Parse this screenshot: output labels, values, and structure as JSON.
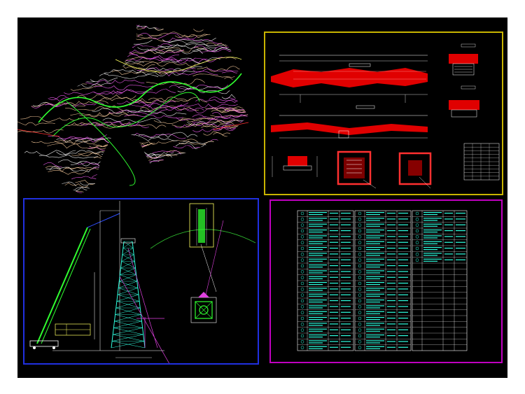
{
  "drawing": {
    "background": "#000000",
    "frame_colors": {
      "bridge": "#c8b400",
      "tower": "#2030e0",
      "table": "#c000c0"
    }
  },
  "topo": {
    "contour_colors": [
      "#ffffff",
      "#ff60ff",
      "#ffd0a0",
      "#ff3030",
      "#30ff30",
      "#ffff60"
    ]
  },
  "bridge": {
    "elevation_title": "",
    "plan_title": "",
    "section_a_title": "",
    "section_b_title": "",
    "section_c_title": "",
    "side_title_1": "",
    "side_title_2": ""
  },
  "tower": {
    "caption": "",
    "legend_lines": [
      "",
      ""
    ]
  },
  "table": {
    "columns": 3,
    "rows_per_column": 24
  }
}
